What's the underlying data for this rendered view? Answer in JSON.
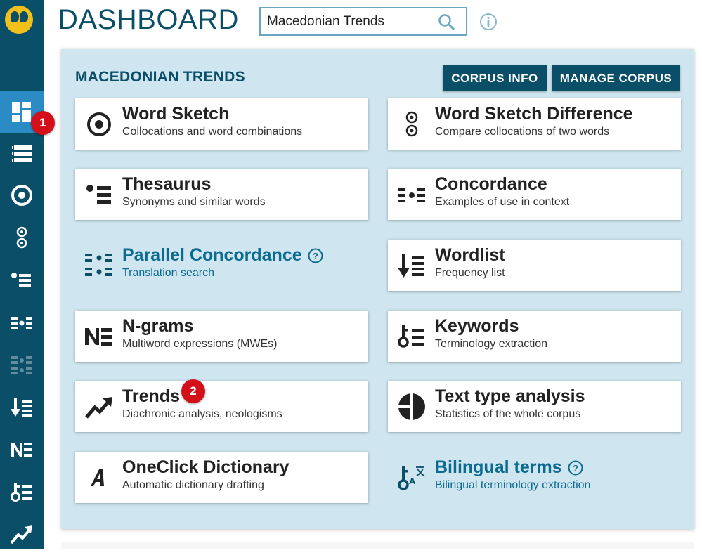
{
  "header": {
    "title": "DASHBOARD"
  },
  "search": {
    "value": "Macedonian Trends",
    "icon": "search-icon"
  },
  "panel": {
    "title": "MACEDONIAN TRENDS",
    "buttons": {
      "corpus_info": "CORPUS INFO",
      "manage_corpus": "MANAGE CORPUS"
    }
  },
  "tools": [
    {
      "name": "Word Sketch",
      "desc": "Collocations and word combinations",
      "icon": "word-sketch-icon"
    },
    {
      "name": "Word Sketch Difference",
      "desc": "Compare collocations of two words",
      "icon": "word-sketch-difference-icon"
    },
    {
      "name": "Thesaurus",
      "desc": "Synonyms and similar words",
      "icon": "thesaurus-icon"
    },
    {
      "name": "Concordance",
      "desc": "Examples of use in context",
      "icon": "concordance-icon"
    },
    {
      "name": "Parallel Concordance",
      "desc": "Translation search",
      "icon": "parallel-concordance-icon"
    },
    {
      "name": "Wordlist",
      "desc": "Frequency list",
      "icon": "wordlist-icon"
    },
    {
      "name": "N-grams",
      "desc": "Multiword expressions (MWEs)",
      "icon": "ngrams-icon"
    },
    {
      "name": "Keywords",
      "desc": "Terminology extraction",
      "icon": "keywords-icon"
    },
    {
      "name": "Trends",
      "desc": "Diachronic analysis, neologisms",
      "icon": "trends-icon"
    },
    {
      "name": "Text type analysis",
      "desc": "Statistics of the whole corpus",
      "icon": "text-type-analysis-icon"
    },
    {
      "name": "OneClick Dictionary",
      "desc": "Automatic dictionary drafting",
      "icon": "oneclick-dictionary-icon"
    },
    {
      "name": "Bilingual terms",
      "desc": "Bilingual terminology extraction",
      "icon": "bilingual-terms-icon"
    }
  ],
  "badges": {
    "b1": "1",
    "b2": "2"
  },
  "colors": {
    "sidebar": "#0a4e68",
    "active": "#2b8bc5",
    "panel": "#cfe6f0",
    "accent": "#0a6a90",
    "badge": "#d30f1a"
  }
}
